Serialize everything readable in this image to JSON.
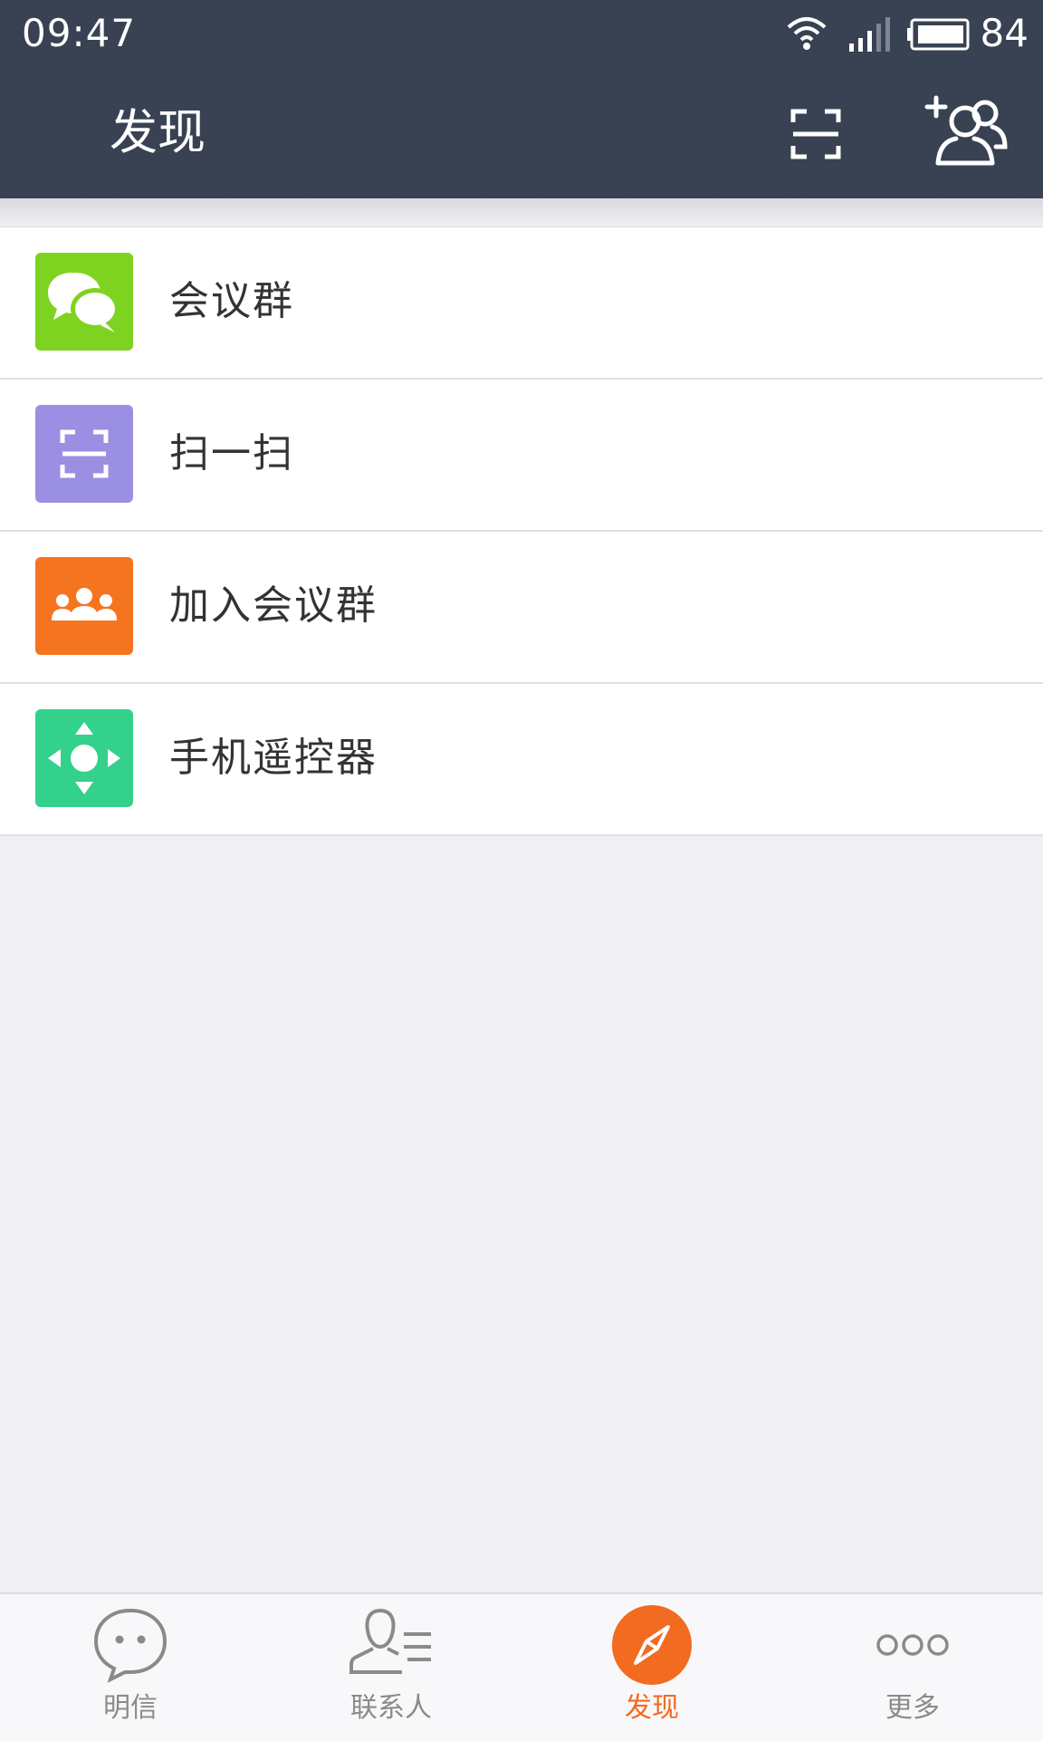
{
  "status_bar": {
    "time": "09:47",
    "battery": "84"
  },
  "header": {
    "title": "发现",
    "scan_icon": "scan-icon",
    "add_contact_icon": "add-contact-icon"
  },
  "menu": [
    {
      "label": "会议群",
      "icon": "chat-bubbles-icon",
      "color": "#7ed321"
    },
    {
      "label": "扫一扫",
      "icon": "scan-icon",
      "color": "#9b8fe3"
    },
    {
      "label": "加入会议群",
      "icon": "group-icon",
      "color": "#f5741f"
    },
    {
      "label": "手机遥控器",
      "icon": "remote-dpad-icon",
      "color": "#33d18b"
    }
  ],
  "tabs": [
    {
      "label": "明信",
      "icon": "chat-icon",
      "active": false
    },
    {
      "label": "联系人",
      "icon": "contacts-icon",
      "active": false
    },
    {
      "label": "发现",
      "icon": "compass-icon",
      "active": true
    },
    {
      "label": "更多",
      "icon": "more-icon",
      "active": false
    }
  ],
  "colors": {
    "header_bg": "#384252",
    "accent": "#f26b21",
    "page_bg": "#efeff4"
  }
}
